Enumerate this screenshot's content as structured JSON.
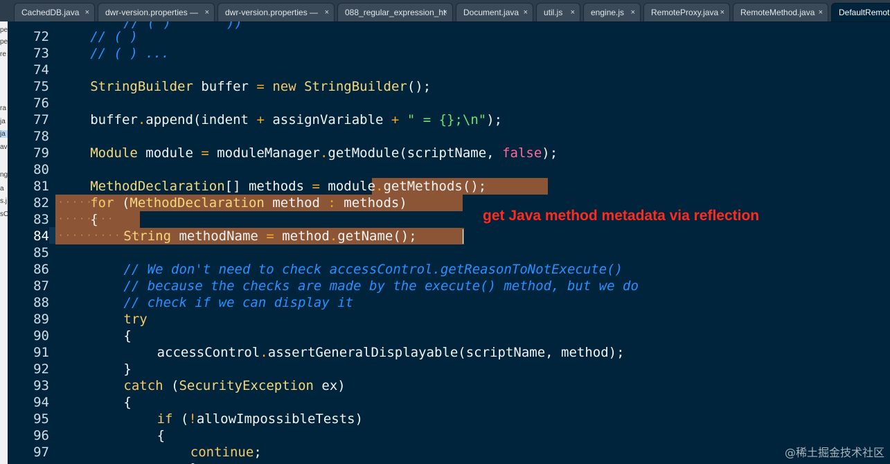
{
  "tabs": [
    {
      "label": "CachedDB.java",
      "active": false
    },
    {
      "label": "dwr-version.properties — ",
      "active": false
    },
    {
      "label": "dwr-version.properties — ",
      "active": false
    },
    {
      "label": "088_regular_expression_ht",
      "active": false
    },
    {
      "label": "Document.java",
      "active": false
    },
    {
      "label": "util.js",
      "active": false
    },
    {
      "label": "engine.js",
      "active": false
    },
    {
      "label": "RemoteProxy.java",
      "active": false
    },
    {
      "label": "RemoteMethod.java",
      "active": false
    },
    {
      "label": "DefaultRemote",
      "active": true
    }
  ],
  "tab_close_glyph": "×",
  "left_strip_fragments": [
    "pe",
    "pe",
    "re",
    "ra",
    "ja",
    "ja",
    "av",
    "ng",
    "a",
    "s.j",
    "sO"
  ],
  "line_numbers": [
    "72",
    "73",
    "74",
    "75",
    "76",
    "77",
    "78",
    "79",
    "80",
    "81",
    "82",
    "83",
    "84",
    "85",
    "86",
    "87",
    "88",
    "89",
    "90",
    "91",
    "92",
    "93",
    "94",
    "95",
    "96",
    "97"
  ],
  "current_line": "84",
  "code_lines": [
    {
      "number": "72",
      "indent": 1,
      "tokens": [
        {
          "t": "// ( )",
          "c": "cm"
        }
      ]
    },
    {
      "number": "73",
      "indent": 1,
      "tokens": [
        {
          "t": "// ( ) ...",
          "c": "cm"
        }
      ]
    },
    {
      "number": "74",
      "indent": 0,
      "tokens": []
    },
    {
      "number": "75",
      "indent": 1,
      "tokens": [
        {
          "t": "StringBuilder",
          "c": "ty"
        },
        {
          "t": " buffer ",
          "c": "pl"
        },
        {
          "t": "=",
          "c": "op"
        },
        {
          "t": " ",
          "c": "pl"
        },
        {
          "t": "new",
          "c": "kw"
        },
        {
          "t": " ",
          "c": "pl"
        },
        {
          "t": "StringBuilder",
          "c": "ty"
        },
        {
          "t": "();",
          "c": "pl"
        }
      ]
    },
    {
      "number": "76",
      "indent": 0,
      "tokens": []
    },
    {
      "number": "77",
      "indent": 1,
      "tokens": [
        {
          "t": "buffer",
          "c": "pl"
        },
        {
          "t": ".",
          "c": "op"
        },
        {
          "t": "append(indent ",
          "c": "pl"
        },
        {
          "t": "+",
          "c": "op"
        },
        {
          "t": " assignVariable ",
          "c": "pl"
        },
        {
          "t": "+",
          "c": "op"
        },
        {
          "t": " ",
          "c": "pl"
        },
        {
          "t": "\" = {};\\n\"",
          "c": "str"
        },
        {
          "t": ");",
          "c": "pl"
        }
      ]
    },
    {
      "number": "78",
      "indent": 0,
      "tokens": []
    },
    {
      "number": "79",
      "indent": 1,
      "tokens": [
        {
          "t": "Module",
          "c": "ty"
        },
        {
          "t": " module ",
          "c": "pl"
        },
        {
          "t": "=",
          "c": "op"
        },
        {
          "t": " moduleManager",
          "c": "pl"
        },
        {
          "t": ".",
          "c": "op"
        },
        {
          "t": "getModule(scriptName, ",
          "c": "pl"
        },
        {
          "t": "false",
          "c": "bool"
        },
        {
          "t": ");",
          "c": "pl"
        }
      ]
    },
    {
      "number": "80",
      "indent": 0,
      "tokens": []
    },
    {
      "number": "81",
      "indent": 1,
      "tokens": [
        {
          "t": "MethodDeclaration",
          "c": "ty"
        },
        {
          "t": "[] methods ",
          "c": "pl"
        },
        {
          "t": "=",
          "c": "op"
        },
        {
          "t": " module",
          "c": "pl"
        },
        {
          "t": ".",
          "c": "op"
        },
        {
          "t": "getMethods();",
          "c": "pl"
        }
      ]
    },
    {
      "number": "82",
      "indent": 1,
      "tokens": [
        {
          "t": "for",
          "c": "kw"
        },
        {
          "t": " (",
          "c": "pl"
        },
        {
          "t": "MethodDeclaration",
          "c": "ty"
        },
        {
          "t": " method ",
          "c": "pl"
        },
        {
          "t": ":",
          "c": "op"
        },
        {
          "t": " methods)",
          "c": "pl"
        }
      ]
    },
    {
      "number": "83",
      "indent": 1,
      "tokens": [
        {
          "t": "{",
          "c": "pl"
        }
      ]
    },
    {
      "number": "84",
      "indent": 2,
      "tokens": [
        {
          "t": "String",
          "c": "ty"
        },
        {
          "t": " methodName ",
          "c": "pl"
        },
        {
          "t": "=",
          "c": "op"
        },
        {
          "t": " method",
          "c": "pl"
        },
        {
          "t": ".",
          "c": "op"
        },
        {
          "t": "getName();",
          "c": "pl"
        }
      ]
    },
    {
      "number": "85",
      "indent": 0,
      "tokens": []
    },
    {
      "number": "86",
      "indent": 2,
      "tokens": [
        {
          "t": "// We don't need to check accessControl.getReasonToNotExecute()",
          "c": "cm"
        }
      ]
    },
    {
      "number": "87",
      "indent": 2,
      "tokens": [
        {
          "t": "// because the checks are made by the execute() method, but we do",
          "c": "cm"
        }
      ]
    },
    {
      "number": "88",
      "indent": 2,
      "tokens": [
        {
          "t": "// check if we can display it",
          "c": "cm"
        }
      ]
    },
    {
      "number": "89",
      "indent": 2,
      "tokens": [
        {
          "t": "try",
          "c": "kw"
        }
      ]
    },
    {
      "number": "90",
      "indent": 2,
      "tokens": [
        {
          "t": "{",
          "c": "pl"
        }
      ]
    },
    {
      "number": "91",
      "indent": 3,
      "tokens": [
        {
          "t": "accessControl",
          "c": "pl"
        },
        {
          "t": ".",
          "c": "op"
        },
        {
          "t": "assertGeneralDisplayable(scriptName, method);",
          "c": "pl"
        }
      ]
    },
    {
      "number": "92",
      "indent": 2,
      "tokens": [
        {
          "t": "}",
          "c": "pl"
        }
      ]
    },
    {
      "number": "93",
      "indent": 2,
      "tokens": [
        {
          "t": "catch",
          "c": "kw"
        },
        {
          "t": " (",
          "c": "pl"
        },
        {
          "t": "SecurityException",
          "c": "ty"
        },
        {
          "t": " ex)",
          "c": "pl"
        }
      ]
    },
    {
      "number": "94",
      "indent": 2,
      "tokens": [
        {
          "t": "{",
          "c": "pl"
        }
      ]
    },
    {
      "number": "95",
      "indent": 3,
      "tokens": [
        {
          "t": "if",
          "c": "kw"
        },
        {
          "t": " (",
          "c": "pl"
        },
        {
          "t": "!",
          "c": "op"
        },
        {
          "t": "allowImpossibleTests)",
          "c": "pl"
        }
      ]
    },
    {
      "number": "96",
      "indent": 3,
      "tokens": [
        {
          "t": "{",
          "c": "pl"
        }
      ]
    },
    {
      "number": "97",
      "indent": 4,
      "tokens": [
        {
          "t": "continue",
          "c": "kw"
        },
        {
          "t": ";",
          "c": "pl"
        }
      ]
    }
  ],
  "partial_top_line": "// ( )       ))",
  "partial_bottom_line": "}",
  "annotation": "get Java method metadata via reflection",
  "watermark": "@稀土掘金技术社区",
  "colors": {
    "editor_bg": "#00243c",
    "selection": "#8c5535",
    "keyword": "#f5c86b",
    "type": "#f5d77d",
    "operator": "#f5a623",
    "string": "#6ee26e",
    "comment": "#2a8fff",
    "boolean": "#ff6a9b",
    "annotation": "#ff2b1f"
  }
}
